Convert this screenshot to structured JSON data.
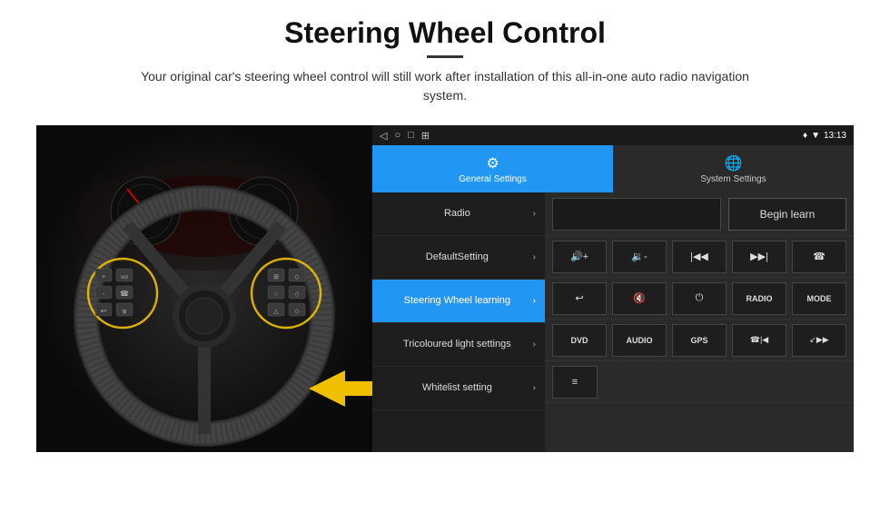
{
  "header": {
    "title": "Steering Wheel Control",
    "subtitle": "Your original car's steering wheel control will still work after installation of this all-in-one auto radio navigation system."
  },
  "status_bar": {
    "nav_icons": [
      "◁",
      "○",
      "□",
      "⊞"
    ],
    "right_icons": "♦ ▼ 13:13"
  },
  "tabs": [
    {
      "id": "general",
      "label": "General Settings",
      "active": true
    },
    {
      "id": "system",
      "label": "System Settings",
      "active": false
    }
  ],
  "menu_items": [
    {
      "id": "radio",
      "label": "Radio",
      "active": false
    },
    {
      "id": "default",
      "label": "DefaultSetting",
      "active": false
    },
    {
      "id": "steering",
      "label": "Steering Wheel learning",
      "active": true
    },
    {
      "id": "tricoloured",
      "label": "Tricoloured light settings",
      "active": false
    },
    {
      "id": "whitelist",
      "label": "Whitelist setting",
      "active": false
    }
  ],
  "controls": {
    "begin_learn_label": "Begin learn",
    "row2": [
      "▶+",
      "◀-",
      "|◀◀",
      "▶▶|",
      "☎"
    ],
    "row3": [
      "↩",
      "🔇",
      "⏻",
      "RADIO",
      "MODE"
    ],
    "row4_labels": [
      "DVD",
      "AUDIO",
      "GPS",
      "☎|◀◀",
      "↙▶▶|"
    ],
    "row5": [
      "≡"
    ]
  },
  "colors": {
    "active_blue": "#2196F3",
    "dark_bg": "#1e1e1e",
    "panel_bg": "#2a2a2a"
  }
}
